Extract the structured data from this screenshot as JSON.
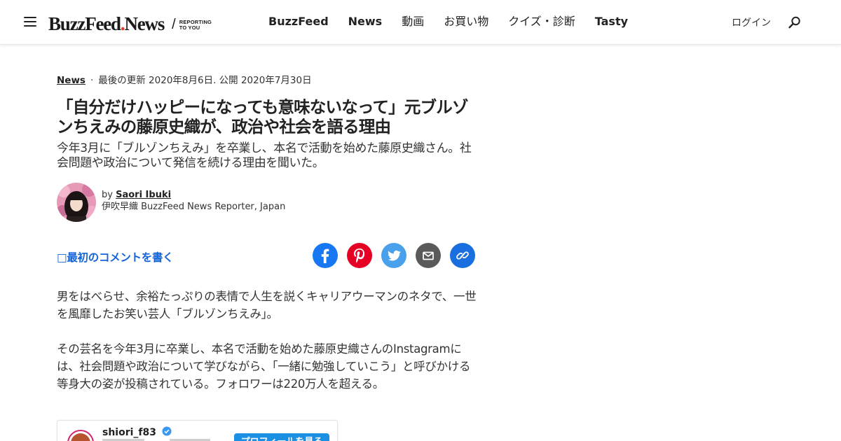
{
  "header": {
    "logo_main": "BuzzFeed",
    "logo_news": "News",
    "logo_tagline_line1": "REPORTING",
    "logo_tagline_line2": "TO YOU",
    "nav": [
      {
        "label": "BuzzFeed"
      },
      {
        "label": "News"
      },
      {
        "label": "動画"
      },
      {
        "label": "お買い物"
      },
      {
        "label": "クイズ・診断"
      },
      {
        "label": "Tasty"
      }
    ],
    "login_label": "ログイン",
    "icons": {
      "menu": "hamburger-menu-icon",
      "search": "search-icon"
    }
  },
  "article": {
    "category": "News",
    "updated": "最後の更新 2020年8月6日. 公開 2020年7月30日",
    "headline": "「自分だけハッピーになっても意味ないなって」元ブルゾンちえみの藤原史織が、政治や社会を語る理由",
    "dek": "今年3月に「ブルゾンちえみ」を卒業し、本名で活動を始めた藤原史織さん。社会問題や政治について発信を続ける理由を聞いた。",
    "byline_prefix": "by",
    "author": "Saori Ibuki",
    "author_title": "伊吹早織 BuzzFeed News Reporter, Japan",
    "comment_link": "最初のコメントを書く",
    "paragraphs": [
      "男をはべらせ、余裕たっぷりの表情で人生を説くキャリアウーマンのネタで、一世を風靡したお笑い芸人「ブルゾンちえみ」。",
      "その芸名を今年3月に卒業し、本名で活動を始めた藤原史織さんのInstagramには、社会問題や政治について学びながら、「一緒に勉強していこう」と呼びかける等身大の姿が投稿されている。フォロワーは220万人を超える。"
    ]
  },
  "share": [
    {
      "name": "facebook",
      "color": "#1877f2"
    },
    {
      "name": "pinterest",
      "color": "#e60023"
    },
    {
      "name": "twitter",
      "color": "#4aa1eb"
    },
    {
      "name": "email",
      "color": "#5a5a5a"
    },
    {
      "name": "copy-link",
      "color": "#1a6fe0"
    }
  ],
  "instagram_embed": {
    "username": "shiori_f83",
    "button_label": "プロフィールを見る"
  },
  "colors": {
    "accent_blue": "#1565d8",
    "logo_dot": "#ee3322"
  }
}
